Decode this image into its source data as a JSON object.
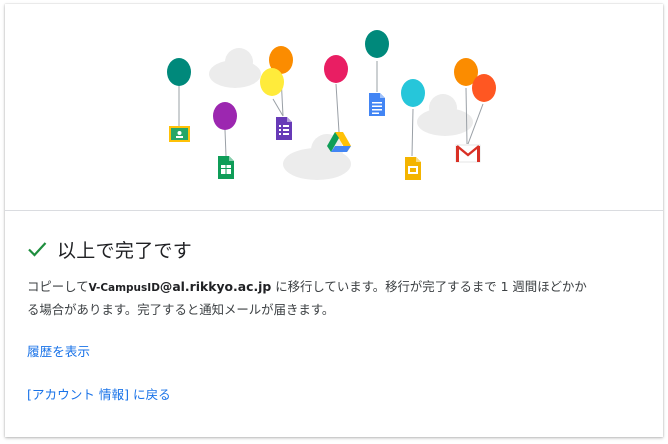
{
  "heading": {
    "title": "以上で完了です"
  },
  "message": {
    "prefix": "コピーして",
    "email_user": "V-CampusID",
    "email_domain": "@al.rikkyo.ac.jp",
    "line1_rest": " に移行しています。移行が完了するまで 1 週間ほどかか",
    "line2": "る場合があります。完了すると通知メールが届きます。"
  },
  "links": {
    "history": "履歴を表示",
    "back_to_account": "[アカウント 情報] に戻る"
  },
  "colors": {
    "accent_link": "#1a73e8",
    "check_green": "#1e8e3e",
    "divider": "#dadce0"
  },
  "illustration": {
    "items": [
      "google-classroom-icon",
      "google-sheets-icon",
      "google-forms-icon",
      "google-drive-icon",
      "google-docs-icon",
      "google-slides-icon",
      "gmail-icon"
    ]
  }
}
